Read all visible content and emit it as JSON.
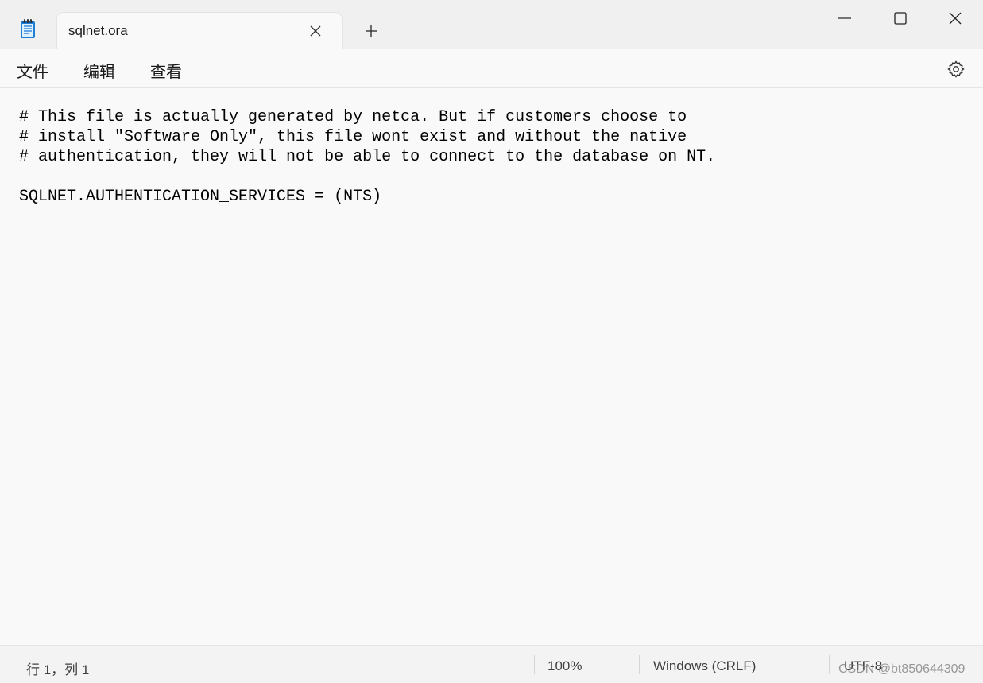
{
  "tab": {
    "title": "sqlnet.ora"
  },
  "menu": {
    "file": "文件",
    "edit": "编辑",
    "view": "查看"
  },
  "editor": {
    "content": "# This file is actually generated by netca. But if customers choose to\n# install \"Software Only\", this file wont exist and without the native\n# authentication, they will not be able to connect to the database on NT.\n\nSQLNET.AUTHENTICATION_SERVICES = (NTS)"
  },
  "status": {
    "position": "行 1，列 1",
    "zoom": "100%",
    "line_ending": "Windows (CRLF)",
    "encoding": "UTF-8"
  },
  "watermark": "CSDN @bt850644309",
  "icons": {
    "app": "notepad-icon",
    "tab_close": "close-icon",
    "new_tab": "plus-icon",
    "minimize": "minimize-icon",
    "maximize": "maximize-icon",
    "close": "close-icon",
    "settings": "gear-icon"
  },
  "colors": {
    "app_icon_accent": "#1e7fd6",
    "background": "#f9f9f9",
    "titlebar": "#f0f0f0"
  }
}
